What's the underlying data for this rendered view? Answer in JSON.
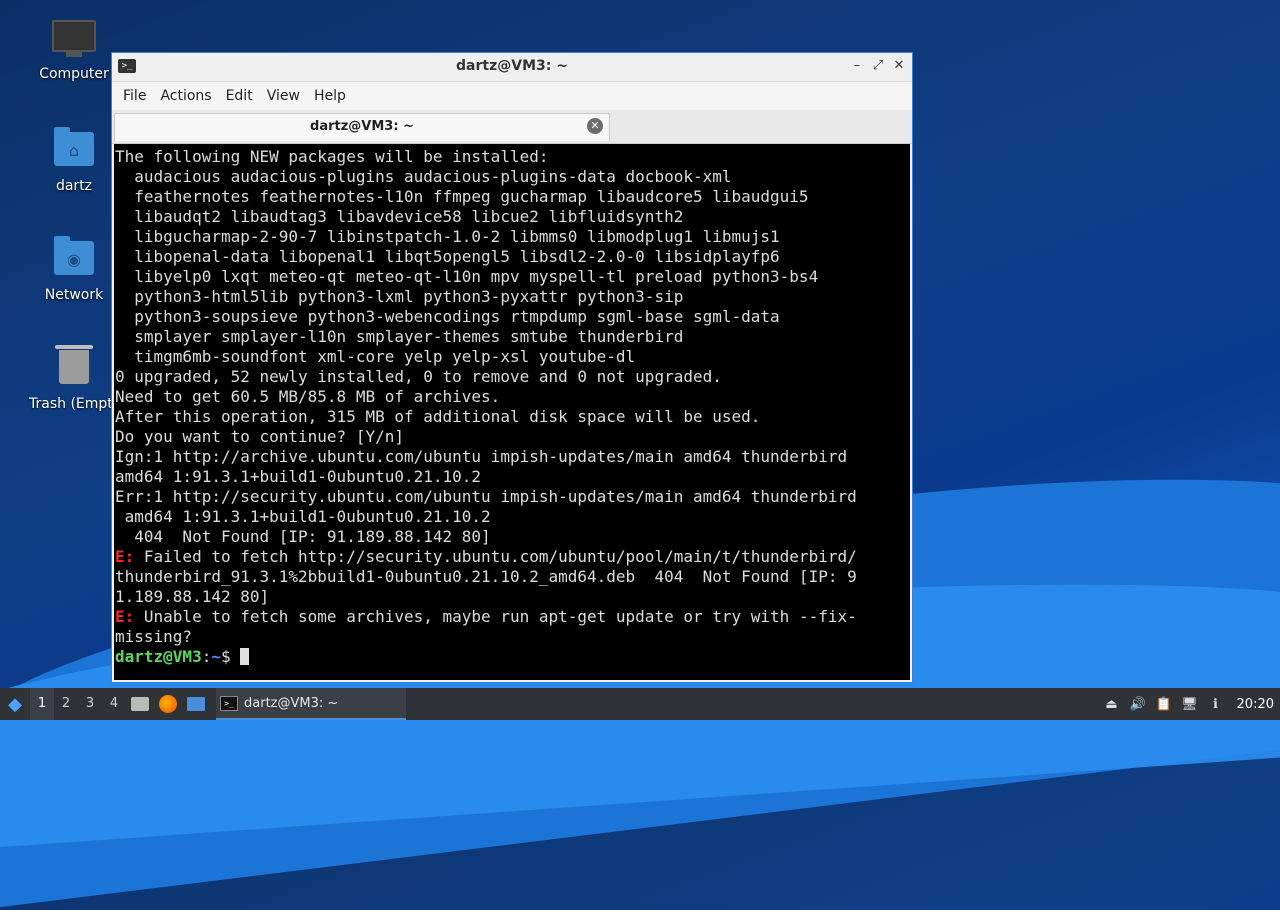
{
  "desktop": {
    "icons": [
      {
        "label": "Computer"
      },
      {
        "label": "dartz"
      },
      {
        "label": "Network"
      },
      {
        "label": "Trash (Empty)"
      }
    ]
  },
  "window": {
    "title": "dartz@VM3: ~",
    "menu": [
      "File",
      "Actions",
      "Edit",
      "View",
      "Help"
    ],
    "tab_title": "dartz@VM3: ~"
  },
  "terminal": {
    "lines": [
      "The following NEW packages will be installed:",
      "  audacious audacious-plugins audacious-plugins-data docbook-xml",
      "  feathernotes feathernotes-l10n ffmpeg gucharmap libaudcore5 libaudgui5",
      "  libaudqt2 libaudtag3 libavdevice58 libcue2 libfluidsynth2",
      "  libgucharmap-2-90-7 libinstpatch-1.0-2 libmms0 libmodplug1 libmujs1",
      "  libopenal-data libopenal1 libqt5opengl5 libsdl2-2.0-0 libsidplayfp6",
      "  libyelp0 lxqt meteo-qt meteo-qt-l10n mpv myspell-tl preload python3-bs4",
      "  python3-html5lib python3-lxml python3-pyxattr python3-sip",
      "  python3-soupsieve python3-webencodings rtmpdump sgml-base sgml-data",
      "  smplayer smplayer-l10n smplayer-themes smtube thunderbird",
      "  timgm6mb-soundfont xml-core yelp yelp-xsl youtube-dl",
      "0 upgraded, 52 newly installed, 0 to remove and 0 not upgraded.",
      "Need to get 60.5 MB/85.8 MB of archives.",
      "After this operation, 315 MB of additional disk space will be used.",
      "Do you want to continue? [Y/n]",
      "Ign:1 http://archive.ubuntu.com/ubuntu impish-updates/main amd64 thunderbird",
      "amd64 1:91.3.1+build1-0ubuntu0.21.10.2",
      "Err:1 http://security.ubuntu.com/ubuntu impish-updates/main amd64 thunderbird",
      " amd64 1:91.3.1+build1-0ubuntu0.21.10.2",
      "  404  Not Found [IP: 91.189.88.142 80]"
    ],
    "error_prefix": "E:",
    "error1_lines": [
      " Failed to fetch http://security.ubuntu.com/ubuntu/pool/main/t/thunderbird/",
      "thunderbird_91.3.1%2bbuild1-0ubuntu0.21.10.2_amd64.deb  404  Not Found [IP: 9",
      "1.189.88.142 80]"
    ],
    "error2_lines": [
      " Unable to fetch some archives, maybe run apt-get update or try with --fix-",
      "missing?"
    ],
    "prompt_user": "dartz@VM3",
    "prompt_sep": ":",
    "prompt_path": "~",
    "prompt_symbol": "$ "
  },
  "taskbar": {
    "workspaces": [
      "1",
      "2",
      "3",
      "4"
    ],
    "active_workspace": "1",
    "task_label": "dartz@VM3: ~",
    "clock": "20:20"
  }
}
